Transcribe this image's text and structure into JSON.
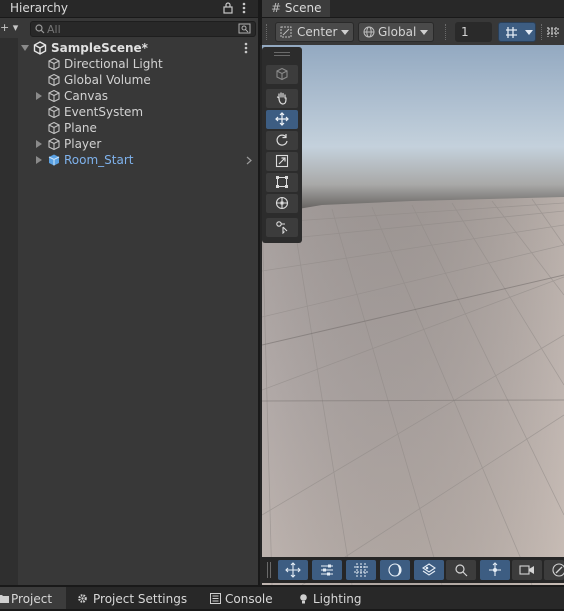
{
  "hierarchy": {
    "tab_title": "Hierarchy",
    "add_label": "+ ▾",
    "search_placeholder": "All",
    "scene_name": "SampleScene*",
    "items": [
      {
        "label": "Directional Light",
        "expandable": false,
        "prefab": false
      },
      {
        "label": "Global Volume",
        "expandable": false,
        "prefab": false
      },
      {
        "label": "Canvas",
        "expandable": true,
        "prefab": false
      },
      {
        "label": "EventSystem",
        "expandable": false,
        "prefab": false
      },
      {
        "label": "Plane",
        "expandable": false,
        "prefab": false
      },
      {
        "label": "Player",
        "expandable": true,
        "prefab": false
      },
      {
        "label": "Room_Start",
        "expandable": true,
        "prefab": true
      }
    ]
  },
  "scene": {
    "tab_title": "Scene",
    "pivot_label": "Center",
    "space_label": "Global",
    "snap_value": "1",
    "tools": [
      "view-cube",
      "hand",
      "move",
      "rotate",
      "scale",
      "rect",
      "transform",
      "custom"
    ],
    "active_tool": "move",
    "overlay_tools": [
      "move-tool",
      "transform-settings",
      "grid",
      "lighting",
      "render-mode",
      "search",
      "pivot",
      "camera",
      "gizmos"
    ]
  },
  "bottom_tabs": [
    {
      "label": "Project",
      "icon": "folder-icon",
      "active": true
    },
    {
      "label": "Project Settings",
      "icon": "gear-icon",
      "active": false
    },
    {
      "label": "Console",
      "icon": "console-icon",
      "active": false
    },
    {
      "label": "Lighting",
      "icon": "bulb-icon",
      "active": false
    }
  ],
  "colors": {
    "selection_blue": "#3d5d82",
    "prefab_text": "#7fb2ec",
    "panel_bg": "#383838"
  }
}
